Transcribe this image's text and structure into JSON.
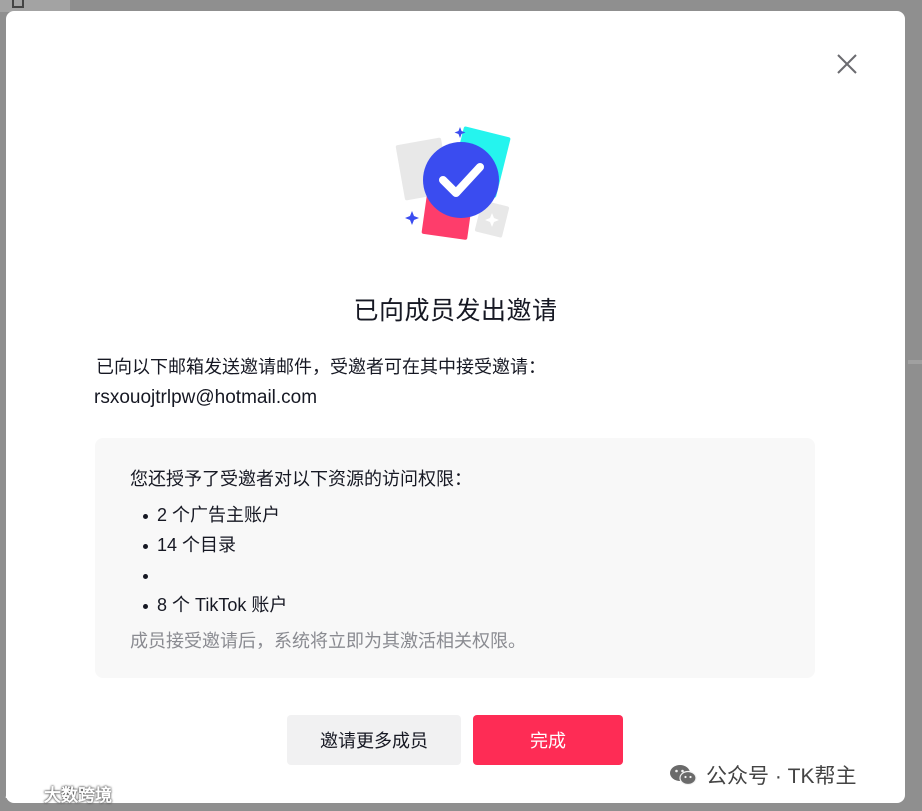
{
  "dialog": {
    "title": "已向成员发出邀请",
    "description": "已向以下邮箱发送邀请邮件，受邀者可在其中接受邀请：",
    "email": "rsxouojtrlpw@hotmail.com",
    "permissions": {
      "heading": "您还授予了受邀者对以下资源的访问权限：",
      "items": [
        "2 个广告主账户",
        "14 个目录",
        "",
        "8 个 TikTok 账户"
      ],
      "note": "成员接受邀请后，系统将立即为其激活相关权限。"
    },
    "buttons": {
      "invite_more": "邀请更多成员",
      "done": "完成"
    }
  },
  "watermarks": {
    "left": "大数跨境",
    "right": "公众号 · TK帮主"
  },
  "icons": {
    "close": "close-icon",
    "illustration": "invite-success-illustration",
    "wechat": "wechat-icon"
  },
  "colors": {
    "primary": "#fe2c55",
    "check_circle": "#3a4cf0",
    "card_cyan": "#25f4ee",
    "card_pink": "#fe3d6b"
  }
}
